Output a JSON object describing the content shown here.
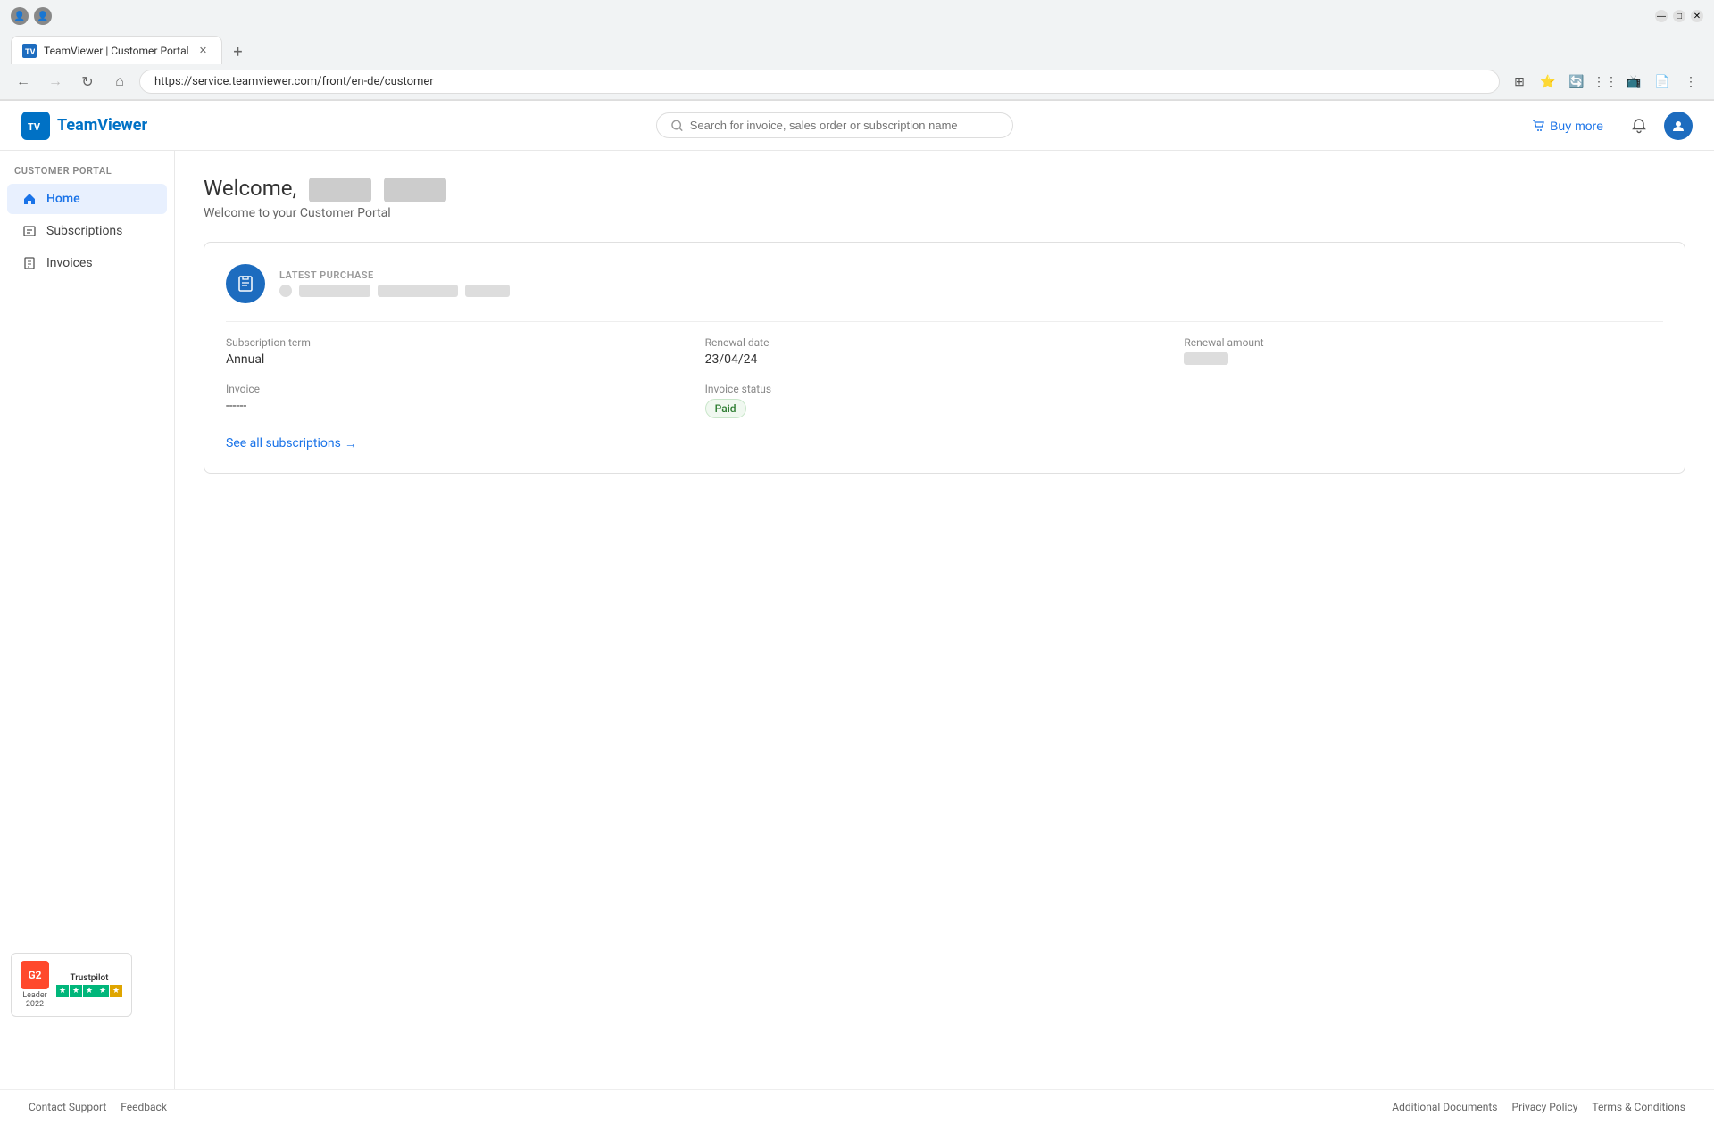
{
  "browser": {
    "url": "https://service.teamviewer.com/front/en-de/customer",
    "tab_title": "TeamViewer | Customer Portal",
    "nav_back_disabled": false,
    "nav_forward_disabled": true
  },
  "header": {
    "logo_text": "TeamViewer",
    "logo_abbr": "TV",
    "search_placeholder": "Search for invoice, sales order or subscription name",
    "buy_more_label": "Buy more",
    "notification_icon": "bell-icon",
    "avatar_icon": "user-avatar"
  },
  "sidebar": {
    "section_label": "CUSTOMER PORTAL",
    "items": [
      {
        "id": "home",
        "label": "Home",
        "icon": "home-icon",
        "active": true
      },
      {
        "id": "subscriptions",
        "label": "Subscriptions",
        "icon": "subscriptions-icon",
        "active": false
      },
      {
        "id": "invoices",
        "label": "Invoices",
        "icon": "invoices-icon",
        "active": false
      }
    ]
  },
  "main": {
    "welcome_prefix": "Welcome,",
    "welcome_subtitle": "Welcome to your Customer Portal",
    "card": {
      "latest_purchase_label": "LATEST PURCHASE",
      "purchase_icon": "clipboard-icon",
      "subscription_term_label": "Subscription term",
      "subscription_term_value": "Annual",
      "renewal_date_label": "Renewal date",
      "renewal_date_value": "23/04/24",
      "renewal_amount_label": "Renewal amount",
      "invoice_label": "Invoice",
      "invoice_value": "------",
      "invoice_status_label": "Invoice status",
      "invoice_status_value": "Paid",
      "see_all_label": "See all subscriptions",
      "see_all_arrow": "→"
    }
  },
  "footer": {
    "contact_support": "Contact Support",
    "feedback": "Feedback",
    "additional_documents": "Additional Documents",
    "privacy_policy": "Privacy Policy",
    "terms_conditions": "Terms & Conditions"
  },
  "trustpilot": {
    "g2_label": "Leader",
    "g2_year": "2022",
    "tp_label": "Trustpilot"
  }
}
